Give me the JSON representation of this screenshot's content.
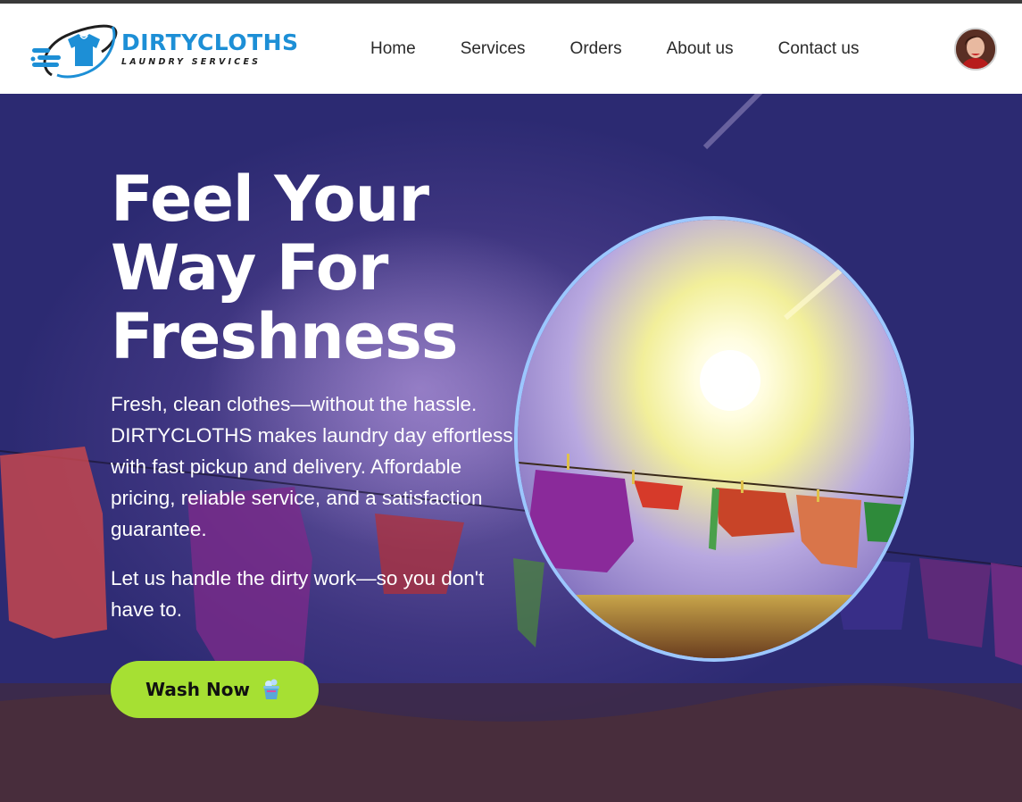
{
  "brand": {
    "name": "DIRTYCLOTHS",
    "tagline": "LAUNDRY SERVICES",
    "colors": {
      "primary": "#1d8fd6",
      "accent": "#a6e033",
      "photo_border": "#9cc7ff"
    }
  },
  "nav": {
    "items": [
      {
        "label": "Home"
      },
      {
        "label": "Services"
      },
      {
        "label": "Orders"
      },
      {
        "label": "About us"
      },
      {
        "label": "Contact us"
      }
    ]
  },
  "user": {
    "avatar_icon": "user-avatar"
  },
  "hero": {
    "title": "Feel Your Way For Freshness",
    "paragraph1": "Fresh, clean clothes—without the hassle. DIRTYCLOTHS makes laundry day effortless with fast pickup and delivery. Affordable pricing, reliable service, and a satisfaction guarantee.",
    "paragraph2": "Let us handle the dirty work—so you don't have to.",
    "cta_label": "Wash Now",
    "cta_icon": "bucket-icon",
    "image_subject": "clothesline-sunset-icon"
  }
}
